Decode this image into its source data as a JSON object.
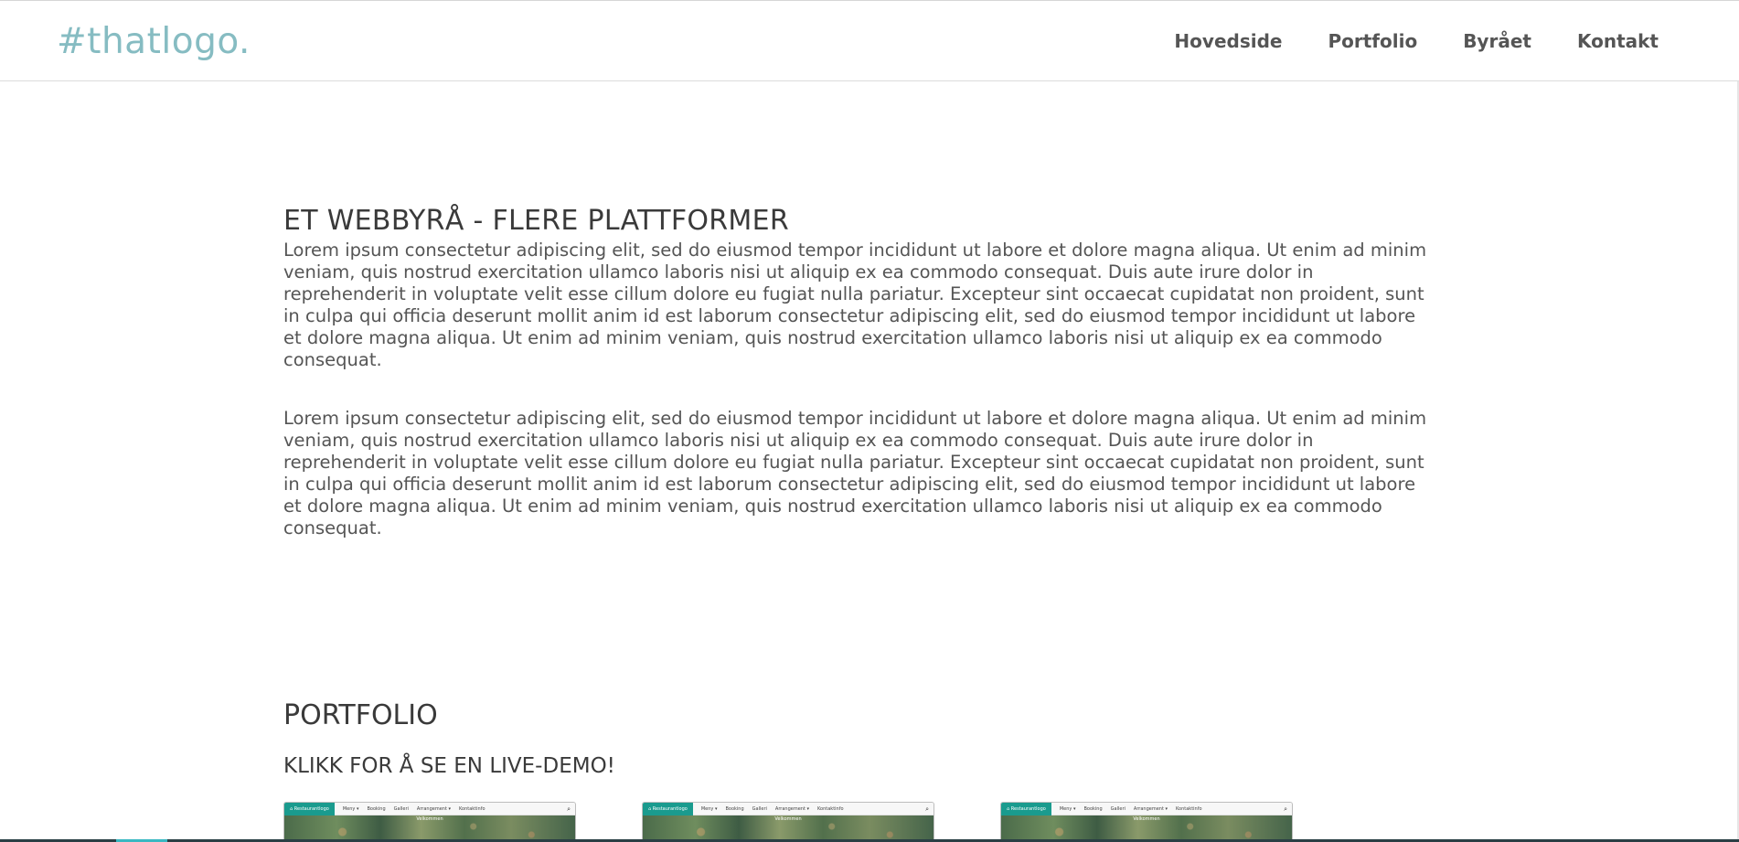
{
  "header": {
    "logo": "#thatlogo.",
    "nav": [
      "Hovedside",
      "Portfolio",
      "Byrået",
      "Kontakt"
    ]
  },
  "intro": {
    "heading": "ET WEBBYRÅ - FLERE PLATTFORMER",
    "paragraphs": [
      "Lorem ipsum consectetur adipiscing elit, sed do eiusmod tempor incididunt ut labore et dolore magna aliqua. Ut enim ad minim veniam, quis nostrud exercitation ullamco laboris nisi ut aliquip ex ea commodo consequat. Duis aute irure dolor in reprehenderit in voluptate velit esse cillum dolore eu fugiat nulla pariatur. Excepteur sint occaecat cupidatat non proident, sunt in culpa qui officia deserunt mollit anim id est laborum consectetur adipiscing elit, sed do eiusmod tempor incididunt ut labore et dolore magna aliqua. Ut enim ad minim veniam, quis nostrud exercitation ullamco laboris nisi ut aliquip ex ea commodo consequat.",
      "Lorem ipsum consectetur adipiscing elit, sed do eiusmod tempor incididunt ut labore et dolore magna aliqua. Ut enim ad minim veniam, quis nostrud exercitation ullamco laboris nisi ut aliquip ex ea commodo consequat. Duis aute irure dolor in reprehenderit in voluptate velit esse cillum dolore eu fugiat nulla pariatur. Excepteur sint occaecat cupidatat non proident, sunt in culpa qui officia deserunt mollit anim id est laborum consectetur adipiscing elit, sed do eiusmod tempor incididunt ut labore et dolore magna aliqua. Ut enim ad minim veniam, quis nostrud exercitation ullamco laboris nisi ut aliquip ex ea commodo consequat."
    ]
  },
  "portfolio": {
    "heading": "PORTFOLIO",
    "subheading": "KLIKK FOR Å SE EN LIVE-DEMO!",
    "thumbnail": {
      "brand": "Restaurantlogo",
      "links": [
        "Meny ▾",
        "Booking",
        "Galleri",
        "Arrangement ▾",
        "Kontaktinfo"
      ],
      "caption": "Velkommen"
    }
  },
  "colors": {
    "logo": "#86bcc2",
    "thumb_brand": "#1a9b8e",
    "text": "#555555"
  },
  "icons": [
    "home-icon",
    "search-icon"
  ]
}
